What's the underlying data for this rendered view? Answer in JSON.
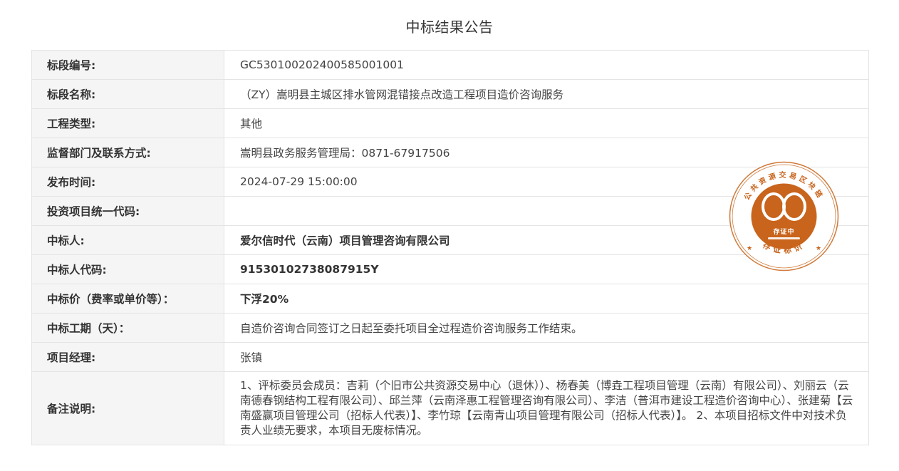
{
  "title": "中标结果公告",
  "rows": [
    {
      "label": "标段编号:",
      "value": "GC5301002024005850010​01"
    },
    {
      "label": "标段名称:",
      "value": "（ZY）嵩明县主城区排水管网混错接点改造工程项目造价咨询服务"
    },
    {
      "label": "工程类型:",
      "value": "其他"
    },
    {
      "label": "监督部门及联系方式:",
      "value": "嵩明县政务服务管理局：0871-67917506"
    },
    {
      "label": "发布时间:",
      "value": "2024-07-29 15:00:00"
    },
    {
      "label": "投资项目统一代码:",
      "value": ""
    },
    {
      "label": "中标人:",
      "value": "爱尔信时代（云南）项目管理咨询有限公司"
    },
    {
      "label": "中标人代码:",
      "value": "91530102738087915Y"
    },
    {
      "label": "中标价（费率或单价等）：",
      "value": "下浮20%"
    },
    {
      "label": "中标工期（天）：",
      "value": "自造价咨询合同签订之日起至委托项目全过程造价咨询服务工作结束。"
    },
    {
      "label": "项目经理:",
      "value": "张镇"
    },
    {
      "label": "备注说明:",
      "value": "1、评标委员会成员：吉莉（个旧市公共资源交易中心（退休））、杨春美（博垚工程项目管理（云南）有限公司）、刘丽云（云南德春钢结构工程有限公司）、邱兰萍（云南泽惠工程管理咨询有限公司）、李洁（普洱市建设工程造价咨询中心）、张建菊【云南盛赢项目管理公司（招标人代表）】、李竹琼【云南青山项目管理有限公司（招标人代表）】。 2、本项目招标文件中对技术负责人业绩无要求，本项目无废标情况。"
    }
  ],
  "seal": {
    "arc_top_text": "公共资源交易区块链",
    "inner_text": "存证中",
    "arc_bottom_text": "存证标识",
    "primary_color": "#c8641c",
    "ring_color": "#cf7a3a"
  }
}
